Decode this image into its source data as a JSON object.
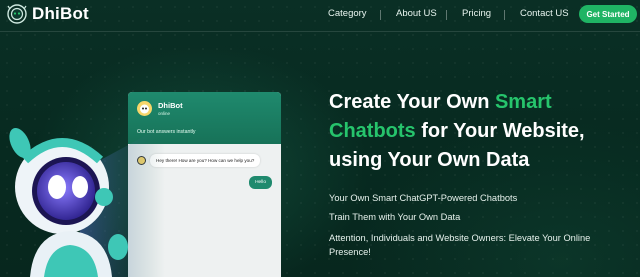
{
  "brand": {
    "name": "DhiBot"
  },
  "nav": {
    "items": [
      {
        "label": "Category"
      },
      {
        "label": "About US"
      },
      {
        "label": "Pricing"
      },
      {
        "label": "Contact US"
      }
    ],
    "cta_label": "Get Started"
  },
  "chat": {
    "bot_name": "DhiBot",
    "status": "online",
    "description": "Our bot answers instantly",
    "incoming_message": "Hey there! How are you? How can we help you?",
    "outgoing_message": "Hello"
  },
  "hero": {
    "title_part1": "Create Your Own ",
    "title_highlight1": "Smart",
    "title_highlight2": "Chatbots",
    "title_part2": " for Your Website,",
    "title_line3": "using Your Own Data",
    "features": [
      "Your Own Smart ChatGPT-Powered Chatbots",
      "Train Them with Your Own Data",
      "Attention, Individuals and Website Owners: Elevate Your Online Presence!"
    ]
  },
  "colors": {
    "background": "#082a21",
    "accent": "#26c46c",
    "button": "#1fb464",
    "chat_header": "#1f8a6e"
  },
  "icons": {
    "logo": "robot-head-icon",
    "avatar": "bot-avatar-icon"
  }
}
